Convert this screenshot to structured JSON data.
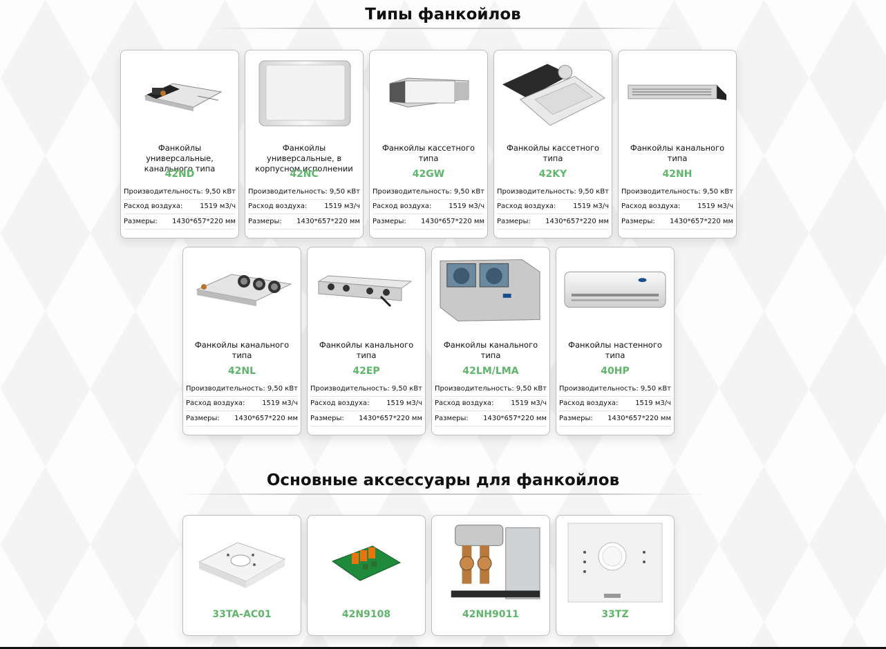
{
  "section_fancoils": {
    "title": "Типы фанкойлов",
    "products": [
      {
        "title": "Фанкойлы универсальные, канального типа",
        "model": "42ND",
        "image": "ducted-fancoil-icon"
      },
      {
        "title": "Фанкойлы универсальные, в корпусном исполнении",
        "model": "42NC",
        "image": "cabinet-fancoil-icon"
      },
      {
        "title": "Фанкойлы кассетного типа",
        "model": "42GW",
        "image": "cassette-fancoil-icon"
      },
      {
        "title": "Фанкойлы кассетного типа",
        "model": "42KY",
        "image": "cassette-panel-fancoil-icon"
      },
      {
        "title": "Фанкойлы канального типа",
        "model": "42NH",
        "image": "slim-duct-fancoil-icon"
      },
      {
        "title": "Фанкойлы канального типа",
        "model": "42NL",
        "image": "round-outlet-fancoil-icon"
      },
      {
        "title": "Фанкойлы канального типа",
        "model": "42EP",
        "image": "multi-outlet-fancoil-icon"
      },
      {
        "title": "Фанкойлы канального типа",
        "model": "42LM/LMA",
        "image": "large-duct-fancoil-icon"
      },
      {
        "title": "Фанкойлы настенного типа",
        "model": "40HP",
        "image": "wall-fancoil-icon"
      }
    ],
    "spec_labels": {
      "capacity": "Производительность:",
      "airflow": "Расход воздуха:",
      "dimensions": "Размеры:"
    },
    "spec_values": {
      "capacity": "9,50 кВт",
      "airflow": "1519 м3/ч",
      "dimensions": "1430*657*220 мм"
    }
  },
  "section_accessories": {
    "title": "Основные аксессуары для фанкойлов",
    "items": [
      {
        "model": "33TA-AC01",
        "image": "thermostat-icon"
      },
      {
        "model": "42N9108",
        "image": "relay-board-icon"
      },
      {
        "model": "42NH9011",
        "image": "valve-kit-icon"
      },
      {
        "model": "33TZ",
        "image": "wall-controller-icon"
      }
    ]
  },
  "colors": {
    "model_green": "#5fb56a",
    "card_border": "#bdbdbd"
  }
}
